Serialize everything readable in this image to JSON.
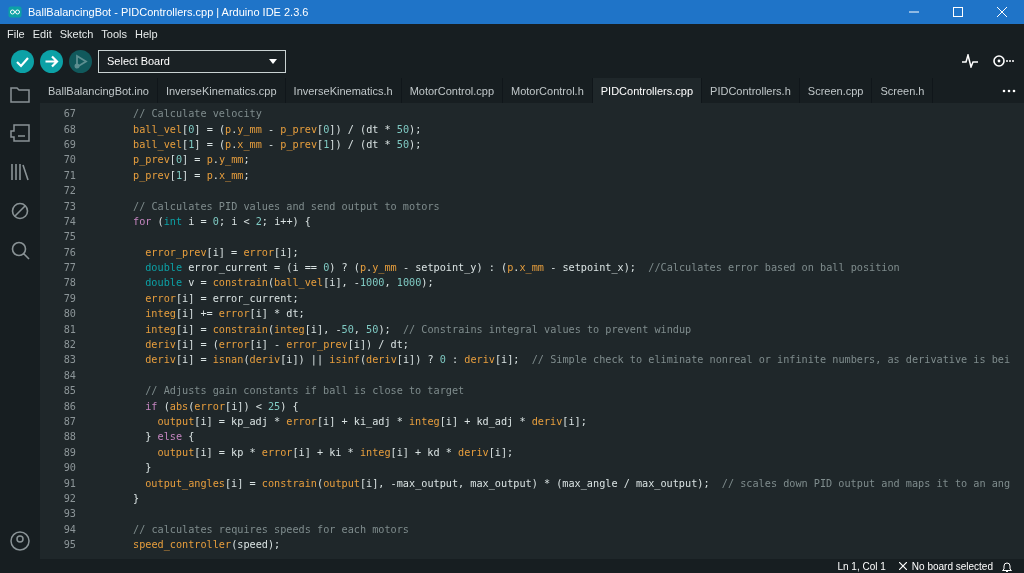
{
  "window": {
    "title": "BallBalancingBot - PIDControllers.cpp | Arduino IDE 2.3.6"
  },
  "menu": [
    "File",
    "Edit",
    "Sketch",
    "Tools",
    "Help"
  ],
  "toolbar": {
    "buttons": [
      {
        "kind": "verify",
        "disabled": false
      },
      {
        "kind": "upload",
        "disabled": false
      },
      {
        "kind": "debug",
        "disabled": true
      }
    ],
    "board_select": {
      "value": "Select Board"
    }
  },
  "tabs": [
    {
      "label": "BallBalancingBot.ino",
      "selected": false
    },
    {
      "label": "InverseKinematics.cpp",
      "selected": false
    },
    {
      "label": "InverseKinematics.h",
      "selected": false
    },
    {
      "label": "MotorControl.cpp",
      "selected": false
    },
    {
      "label": "MotorControl.h",
      "selected": false
    },
    {
      "label": "PIDControllers.cpp",
      "selected": true
    },
    {
      "label": "PIDControllers.h",
      "selected": false
    },
    {
      "label": "Screen.cpp",
      "selected": false
    },
    {
      "label": "Screen.h",
      "selected": false
    }
  ],
  "editor": {
    "lines": [
      {
        "number": "67",
        "kind": "top",
        "tokens": [
          {
            "kind": "comment",
            "text": "// Calculate velocity"
          }
        ]
      },
      {
        "number": "68",
        "kind": "top",
        "tokens": [
          {
            "kind": "var",
            "text": "ball_vel"
          },
          {
            "kind": "plain",
            "text": "["
          },
          {
            "kind": "num",
            "text": "0"
          },
          {
            "kind": "plain",
            "text": "] = ("
          },
          {
            "kind": "var",
            "text": "p"
          },
          {
            "kind": "plain",
            "text": "."
          },
          {
            "kind": "var",
            "text": "y_mm"
          },
          {
            "kind": "plain",
            "text": " - "
          },
          {
            "kind": "var",
            "text": "p_prev"
          },
          {
            "kind": "plain",
            "text": "["
          },
          {
            "kind": "num",
            "text": "0"
          },
          {
            "kind": "plain",
            "text": "]) / (dt * "
          },
          {
            "kind": "num",
            "text": "50"
          },
          {
            "kind": "plain",
            "text": ");"
          }
        ]
      },
      {
        "number": "69",
        "kind": "top",
        "tokens": [
          {
            "kind": "var",
            "text": "ball_vel"
          },
          {
            "kind": "plain",
            "text": "["
          },
          {
            "kind": "num",
            "text": "1"
          },
          {
            "kind": "plain",
            "text": "] = ("
          },
          {
            "kind": "var",
            "text": "p"
          },
          {
            "kind": "plain",
            "text": "."
          },
          {
            "kind": "var",
            "text": "x_mm"
          },
          {
            "kind": "plain",
            "text": " - "
          },
          {
            "kind": "var",
            "text": "p_prev"
          },
          {
            "kind": "plain",
            "text": "["
          },
          {
            "kind": "num",
            "text": "1"
          },
          {
            "kind": "plain",
            "text": "]) / (dt * "
          },
          {
            "kind": "num",
            "text": "50"
          },
          {
            "kind": "plain",
            "text": ");"
          }
        ]
      },
      {
        "number": "70",
        "kind": "top",
        "tokens": [
          {
            "kind": "var",
            "text": "p_prev"
          },
          {
            "kind": "plain",
            "text": "["
          },
          {
            "kind": "num",
            "text": "0"
          },
          {
            "kind": "plain",
            "text": "] = "
          },
          {
            "kind": "var",
            "text": "p"
          },
          {
            "kind": "plain",
            "text": "."
          },
          {
            "kind": "var",
            "text": "y_mm"
          },
          {
            "kind": "plain",
            "text": ";"
          }
        ]
      },
      {
        "number": "71",
        "kind": "top",
        "tokens": [
          {
            "kind": "var",
            "text": "p_prev"
          },
          {
            "kind": "plain",
            "text": "["
          },
          {
            "kind": "num",
            "text": "1"
          },
          {
            "kind": "plain",
            "text": "] = "
          },
          {
            "kind": "var",
            "text": "p"
          },
          {
            "kind": "plain",
            "text": "."
          },
          {
            "kind": "var",
            "text": "x_mm"
          },
          {
            "kind": "plain",
            "text": ";"
          }
        ]
      },
      {
        "number": "72"
      },
      {
        "number": "73",
        "kind": "top",
        "tokens": [
          {
            "kind": "comment",
            "text": "// Calculates PID values and send output to motors"
          }
        ]
      },
      {
        "number": "74",
        "kind": "top",
        "tokens": [
          {
            "kind": "keyword",
            "text": "for"
          },
          {
            "kind": "plain",
            "text": " ("
          },
          {
            "kind": "type",
            "text": "int"
          },
          {
            "kind": "plain",
            "text": " i = "
          },
          {
            "kind": "num",
            "text": "0"
          },
          {
            "kind": "plain",
            "text": "; i < "
          },
          {
            "kind": "num",
            "text": "2"
          },
          {
            "kind": "plain",
            "text": "; i++) {"
          }
        ]
      },
      {
        "number": "75"
      },
      {
        "number": "76",
        "kind": "body",
        "tokens": [
          {
            "kind": "var",
            "text": "error_prev"
          },
          {
            "kind": "plain",
            "text": "[i] = "
          },
          {
            "kind": "var",
            "text": "error"
          },
          {
            "kind": "plain",
            "text": "[i];"
          }
        ]
      },
      {
        "number": "77",
        "kind": "body",
        "tokens": [
          {
            "kind": "type",
            "text": "double"
          },
          {
            "kind": "plain",
            "text": " error_current = (i == "
          },
          {
            "kind": "num",
            "text": "0"
          },
          {
            "kind": "plain",
            "text": ") ? ("
          },
          {
            "kind": "var",
            "text": "p"
          },
          {
            "kind": "plain",
            "text": "."
          },
          {
            "kind": "var",
            "text": "y_mm"
          },
          {
            "kind": "plain",
            "text": " - setpoint_y) : ("
          },
          {
            "kind": "var",
            "text": "p"
          },
          {
            "kind": "plain",
            "text": "."
          },
          {
            "kind": "var",
            "text": "x_mm"
          },
          {
            "kind": "plain",
            "text": " - setpoint_x);  "
          },
          {
            "kind": "comment",
            "text": "//Calculates error based on ball position"
          }
        ]
      },
      {
        "number": "78",
        "kind": "body",
        "tokens": [
          {
            "kind": "type",
            "text": "double"
          },
          {
            "kind": "plain",
            "text": " v = "
          },
          {
            "kind": "var",
            "text": "constrain"
          },
          {
            "kind": "plain",
            "text": "("
          },
          {
            "kind": "var",
            "text": "ball_vel"
          },
          {
            "kind": "plain",
            "text": "[i], -"
          },
          {
            "kind": "num",
            "text": "1000"
          },
          {
            "kind": "plain",
            "text": ", "
          },
          {
            "kind": "num",
            "text": "1000"
          },
          {
            "kind": "plain",
            "text": ");"
          }
        ]
      },
      {
        "number": "79",
        "kind": "body",
        "tokens": [
          {
            "kind": "var",
            "text": "error"
          },
          {
            "kind": "plain",
            "text": "[i] = error_current;"
          }
        ]
      },
      {
        "number": "80",
        "kind": "body",
        "tokens": [
          {
            "kind": "var",
            "text": "integ"
          },
          {
            "kind": "plain",
            "text": "[i] += "
          },
          {
            "kind": "var",
            "text": "error"
          },
          {
            "kind": "plain",
            "text": "[i] * dt;"
          }
        ]
      },
      {
        "number": "81",
        "kind": "body",
        "tokens": [
          {
            "kind": "var",
            "text": "integ"
          },
          {
            "kind": "plain",
            "text": "[i] = "
          },
          {
            "kind": "var",
            "text": "constrain"
          },
          {
            "kind": "plain",
            "text": "("
          },
          {
            "kind": "var",
            "text": "integ"
          },
          {
            "kind": "plain",
            "text": "[i], -"
          },
          {
            "kind": "num",
            "text": "50"
          },
          {
            "kind": "plain",
            "text": ", "
          },
          {
            "kind": "num",
            "text": "50"
          },
          {
            "kind": "plain",
            "text": ");  "
          },
          {
            "kind": "comment",
            "text": "// Constrains integral values to prevent windup"
          }
        ]
      },
      {
        "number": "82",
        "kind": "body",
        "tokens": [
          {
            "kind": "var",
            "text": "deriv"
          },
          {
            "kind": "plain",
            "text": "[i] = ("
          },
          {
            "kind": "var",
            "text": "error"
          },
          {
            "kind": "plain",
            "text": "[i] - "
          },
          {
            "kind": "var",
            "text": "error_prev"
          },
          {
            "kind": "plain",
            "text": "[i]) / dt;"
          }
        ]
      },
      {
        "number": "83",
        "kind": "body",
        "tokens": [
          {
            "kind": "var",
            "text": "deriv"
          },
          {
            "kind": "plain",
            "text": "[i] = "
          },
          {
            "kind": "var",
            "text": "isnan"
          },
          {
            "kind": "plain",
            "text": "("
          },
          {
            "kind": "var",
            "text": "deriv"
          },
          {
            "kind": "plain",
            "text": "[i]) || "
          },
          {
            "kind": "var",
            "text": "isinf"
          },
          {
            "kind": "plain",
            "text": "("
          },
          {
            "kind": "var",
            "text": "deriv"
          },
          {
            "kind": "plain",
            "text": "[i]) ? "
          },
          {
            "kind": "num",
            "text": "0"
          },
          {
            "kind": "plain",
            "text": " : "
          },
          {
            "kind": "var",
            "text": "deriv"
          },
          {
            "kind": "plain",
            "text": "[i];  "
          },
          {
            "kind": "comment",
            "text": "// Simple check to eliminate nonreal or infinite numbers, as derivative is bei"
          }
        ]
      },
      {
        "number": "84"
      },
      {
        "number": "85",
        "kind": "body",
        "tokens": [
          {
            "kind": "comment",
            "text": "// Adjusts gain constants if ball is close to target"
          }
        ]
      },
      {
        "number": "86",
        "kind": "body",
        "tokens": [
          {
            "kind": "keyword",
            "text": "if"
          },
          {
            "kind": "plain",
            "text": " ("
          },
          {
            "kind": "var",
            "text": "abs"
          },
          {
            "kind": "plain",
            "text": "("
          },
          {
            "kind": "var",
            "text": "error"
          },
          {
            "kind": "plain",
            "text": "[i]) < "
          },
          {
            "kind": "num",
            "text": "25"
          },
          {
            "kind": "plain",
            "text": ") {"
          }
        ]
      },
      {
        "number": "87",
        "kind": "inner",
        "tokens": [
          {
            "kind": "var",
            "text": "output"
          },
          {
            "kind": "plain",
            "text": "[i] = kp_adj * "
          },
          {
            "kind": "var",
            "text": "error"
          },
          {
            "kind": "plain",
            "text": "[i] + ki_adj * "
          },
          {
            "kind": "var",
            "text": "integ"
          },
          {
            "kind": "plain",
            "text": "[i] + kd_adj * "
          },
          {
            "kind": "var",
            "text": "deriv"
          },
          {
            "kind": "plain",
            "text": "[i];"
          }
        ]
      },
      {
        "number": "88",
        "kind": "body",
        "tokens": [
          {
            "kind": "plain",
            "text": "} "
          },
          {
            "kind": "keyword",
            "text": "else"
          },
          {
            "kind": "plain",
            "text": " {"
          }
        ]
      },
      {
        "number": "89",
        "kind": "inner",
        "tokens": [
          {
            "kind": "var",
            "text": "output"
          },
          {
            "kind": "plain",
            "text": "[i] = kp * "
          },
          {
            "kind": "var",
            "text": "error"
          },
          {
            "kind": "plain",
            "text": "[i] + ki * "
          },
          {
            "kind": "var",
            "text": "integ"
          },
          {
            "kind": "plain",
            "text": "[i] + kd * "
          },
          {
            "kind": "var",
            "text": "deriv"
          },
          {
            "kind": "plain",
            "text": "[i];"
          }
        ]
      },
      {
        "number": "90",
        "kind": "body",
        "tokens": [
          {
            "kind": "plain",
            "text": "}"
          }
        ]
      },
      {
        "number": "91",
        "kind": "body",
        "tokens": [
          {
            "kind": "var",
            "text": "output_angles"
          },
          {
            "kind": "plain",
            "text": "[i] = "
          },
          {
            "kind": "var",
            "text": "constrain"
          },
          {
            "kind": "plain",
            "text": "("
          },
          {
            "kind": "var",
            "text": "output"
          },
          {
            "kind": "plain",
            "text": "[i], -max_output, max_output) * (max_angle / max_output);  "
          },
          {
            "kind": "comment",
            "text": "// scales down PID output and maps it to an ang"
          }
        ]
      },
      {
        "number": "92",
        "kind": "top",
        "tokens": [
          {
            "kind": "plain",
            "text": "}"
          }
        ]
      },
      {
        "number": "93"
      },
      {
        "number": "94",
        "kind": "top",
        "tokens": [
          {
            "kind": "comment",
            "text": "// calculates requires speeds for each motors"
          }
        ]
      },
      {
        "number": "95",
        "kind": "top",
        "tokens": [
          {
            "kind": "var",
            "text": "speed_controller"
          },
          {
            "kind": "plain",
            "text": "(speed);"
          }
        ]
      }
    ]
  },
  "status_bar": {
    "position": "Ln 1, Col 1",
    "board": "No board selected"
  }
}
